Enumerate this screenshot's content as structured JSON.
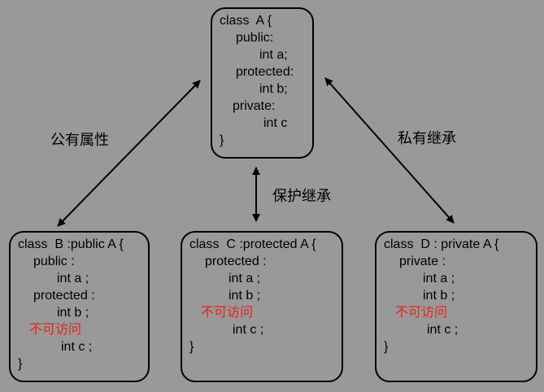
{
  "class_a": {
    "lines": [
      "class  A {",
      "public:",
      "int a;",
      "protected:",
      "int b;",
      "private:",
      "int c",
      "}"
    ]
  },
  "class_b": {
    "lines": [
      "class  B :public A {",
      "public :",
      "int a ;",
      "protected :",
      "int b ;",
      "不可访问",
      "int c ;",
      "}"
    ]
  },
  "class_c": {
    "lines": [
      "class  C :protected A {",
      "protected :",
      "int a ;",
      "int b ;",
      "不可访问",
      "int c ;",
      "}"
    ]
  },
  "class_d": {
    "lines": [
      "class  D : private A {",
      "private :",
      "int a ;",
      "int b ;",
      "不可访问",
      "int c ;",
      "}"
    ]
  },
  "edges": {
    "public_label": "公有属性",
    "protected_label": "保护继承",
    "private_label": "私有继承"
  },
  "colors": {
    "background": "#999999",
    "inaccessible_text": "#e8201a",
    "stroke": "#000000"
  }
}
